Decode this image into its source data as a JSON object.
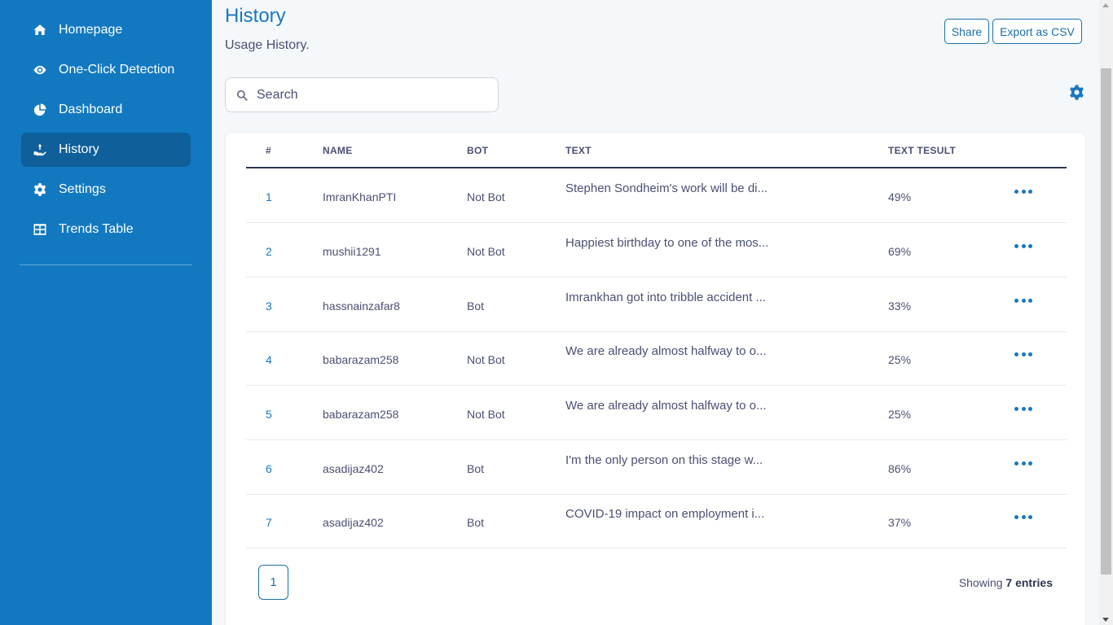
{
  "sidebar": {
    "items": [
      {
        "label": "Homepage",
        "icon": "home-icon"
      },
      {
        "label": "One-Click Detection",
        "icon": "eye-icon"
      },
      {
        "label": "Dashboard",
        "icon": "pie-chart-icon"
      },
      {
        "label": "History",
        "icon": "hand-holding-icon",
        "active": true
      },
      {
        "label": "Settings",
        "icon": "gear-icon"
      },
      {
        "label": "Trends Table",
        "icon": "table-icon"
      }
    ]
  },
  "header": {
    "title": "History",
    "subtitle": "Usage History.",
    "share_label": "Share",
    "export_label": "Export as CSV"
  },
  "search": {
    "placeholder": "Search"
  },
  "table": {
    "columns": [
      "#",
      "NAME",
      "BOT",
      "TEXT",
      "TEXT TESULT"
    ],
    "rows": [
      {
        "num": "1",
        "name": "ImranKhanPTI",
        "bot": "Not Bot",
        "text": "Stephen Sondheim's work will be di...",
        "result": "49%"
      },
      {
        "num": "2",
        "name": "mushii1291",
        "bot": "Not Bot",
        "text": "Happiest birthday to one of the mos...",
        "result": "69%"
      },
      {
        "num": "3",
        "name": "hassnainzafar8",
        "bot": "Bot",
        "text": "Imrankhan got into tribble accident ...",
        "result": "33%"
      },
      {
        "num": "4",
        "name": "babarazam258",
        "bot": "Not Bot",
        "text": "We are already almost halfway to o...",
        "result": "25%"
      },
      {
        "num": "5",
        "name": "babarazam258",
        "bot": "Not Bot",
        "text": "We are already almost halfway to o...",
        "result": "25%"
      },
      {
        "num": "6",
        "name": "asadijaz402",
        "bot": "Bot",
        "text": "I'm the only person on this stage w...",
        "result": "86%"
      },
      {
        "num": "7",
        "name": "asadijaz402",
        "bot": "Bot",
        "text": "COVID-19 impact on employment i...",
        "result": "37%"
      }
    ]
  },
  "pagination": {
    "current_page": "1",
    "showing_prefix": "Showing",
    "showing_count": "7 entries"
  },
  "colors": {
    "sidebar": "#1279c1",
    "sidebar_active": "#0e5f9a",
    "accent": "#1a78bd",
    "background": "#f5f8fb"
  }
}
